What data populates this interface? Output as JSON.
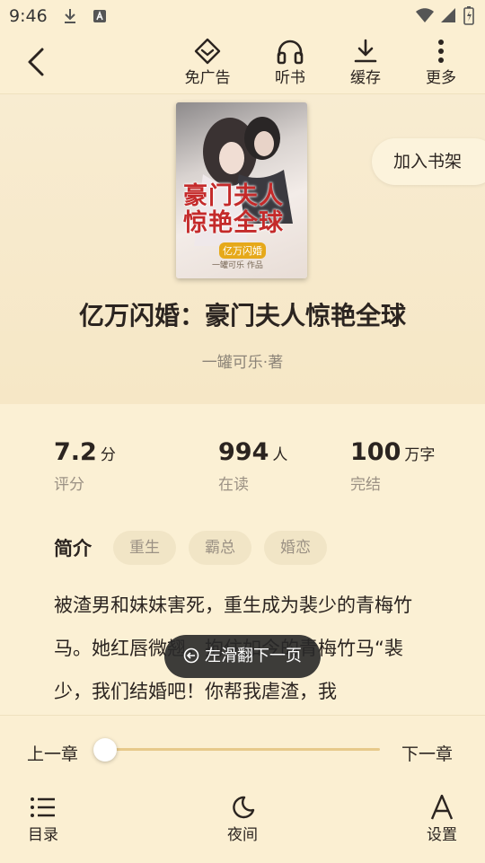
{
  "status_bar": {
    "time": "9:46"
  },
  "top_bar": {
    "back_icon": "back-arrow-icon",
    "actions": [
      {
        "label": "免广告",
        "icon": "ad-free-diamond-icon"
      },
      {
        "label": "听书",
        "icon": "headphones-icon"
      },
      {
        "label": "缓存",
        "icon": "download-icon"
      },
      {
        "label": "更多",
        "icon": "more-vertical-icon"
      }
    ]
  },
  "book": {
    "title": "亿万闪婚：豪门夫人惊艳全球",
    "author": "一罐可乐·著",
    "add_shelf": "加入书架",
    "cover": {
      "title": "豪门夫人惊艳全球",
      "badge": "亿万闪婚",
      "byline": "一罐可乐 作品"
    }
  },
  "stats": [
    {
      "value": "7.2",
      "unit": "分",
      "label": "评分"
    },
    {
      "value": "994",
      "unit": "人",
      "label": "在读"
    },
    {
      "value": "100",
      "unit": "万字",
      "label": "完结"
    }
  ],
  "intro": {
    "heading": "简介",
    "tags": [
      "重生",
      "霸总",
      "婚恋"
    ],
    "text": "被渣男和妹妹害死，重生成为裴少的青梅竹马。她红唇微翘，拘住如今的青梅竹马“裴少，我们结婚吧！你帮我虐渣，我"
  },
  "toast": "左滑翻下一页",
  "reader_controls": {
    "prev_chapter": "上一章",
    "next_chapter": "下一章",
    "progress": 0.0
  },
  "bottom_nav": [
    {
      "label": "目录",
      "icon": "list-icon"
    },
    {
      "label": "夜间",
      "icon": "moon-icon"
    },
    {
      "label": "设置",
      "icon": "font-settings-icon"
    }
  ],
  "colors": {
    "background": "#fbf0d4",
    "accent_track": "#e7c98a",
    "text": "#2b2420",
    "muted": "#9b9184"
  }
}
